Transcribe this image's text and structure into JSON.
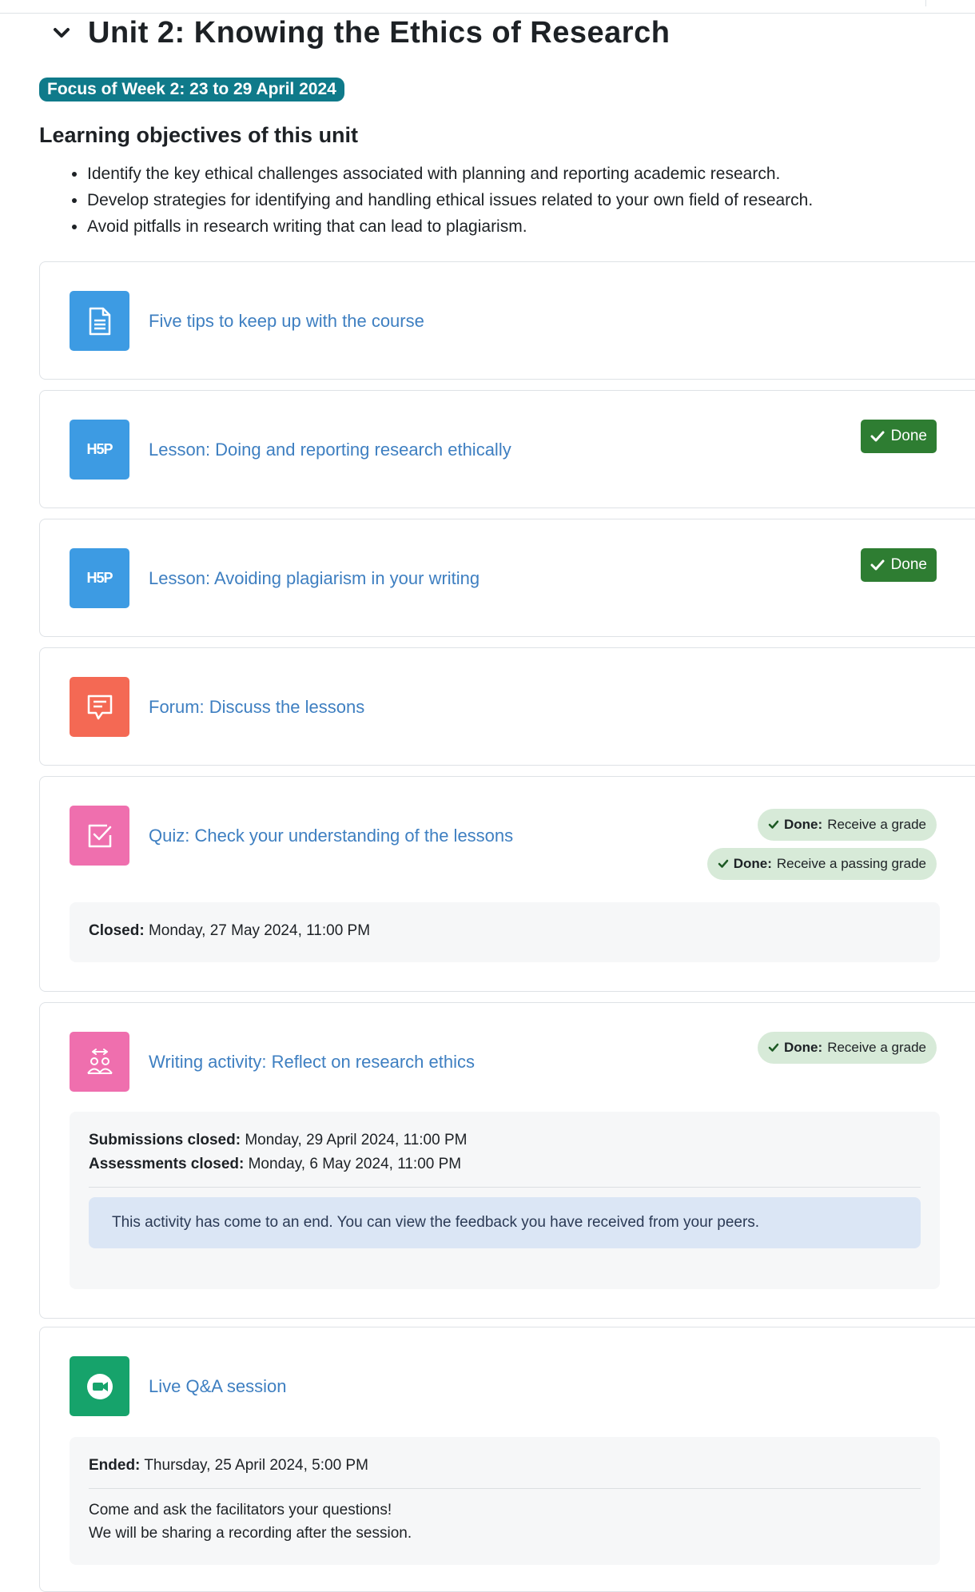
{
  "unit": {
    "title": "Unit 2: Knowing the Ethics of Research",
    "week_badge": "Focus of Week 2: 23 to 29 April 2024",
    "objectives_heading": "Learning objectives of this unit",
    "objectives": [
      "Identify the key ethical challenges associated with planning and reporting academic research.",
      "Develop strategies for identifying and handling ethical issues related to your own field of research.",
      "Avoid pitfalls in research writing that can lead to plagiarism."
    ]
  },
  "colors": {
    "link": "#3e7fc1",
    "badge": "#0f7a8a",
    "done": "#2e7d32",
    "done_pill": "#d7ead8",
    "icon_page": "#3d9be3",
    "icon_forum": "#f46954",
    "icon_quiz": "#ef6fae",
    "icon_meeting": "#16a36b"
  },
  "activities": [
    {
      "title": "Five tips to keep up with the course",
      "icon": "page-icon"
    },
    {
      "title": "Lesson: Doing and reporting research ethically",
      "icon": "h5p-icon",
      "icon_text": "H5P",
      "done": "Done"
    },
    {
      "title": "Lesson: Avoiding plagiarism in your writing",
      "icon": "h5p-icon",
      "icon_text": "H5P",
      "done": "Done"
    },
    {
      "title": "Forum: Discuss the lessons",
      "icon": "forum-icon"
    },
    {
      "title": "Quiz: Check your understanding of the lessons",
      "icon": "quiz-icon",
      "completion": [
        {
          "label": "Done:",
          "text": "Receive a grade"
        },
        {
          "label": "Done:",
          "text": "Receive a passing grade"
        }
      ],
      "dates": [
        {
          "label": "Closed:",
          "value": "Monday, 27 May 2024, 11:00 PM"
        }
      ]
    },
    {
      "title": "Writing activity: Reflect on research ethics",
      "icon": "workshop-icon",
      "completion": [
        {
          "label": "Done:",
          "text": "Receive a grade"
        }
      ],
      "dates": [
        {
          "label": "Submissions closed:",
          "value": "Monday, 29 April 2024, 11:00 PM"
        },
        {
          "label": "Assessments closed:",
          "value": "Monday, 6 May 2024, 11:00 PM"
        }
      ],
      "alert": "This activity has come to an end. You can view the feedback you have received from your peers."
    },
    {
      "title": "Live Q&A session",
      "icon": "video-meeting-icon",
      "dates": [
        {
          "label": "Ended:",
          "value": "Thursday, 25 April 2024, 5:00 PM"
        }
      ],
      "description": [
        "Come and ask the facilitators your questions!",
        "We will be sharing a recording after the session."
      ]
    }
  ]
}
